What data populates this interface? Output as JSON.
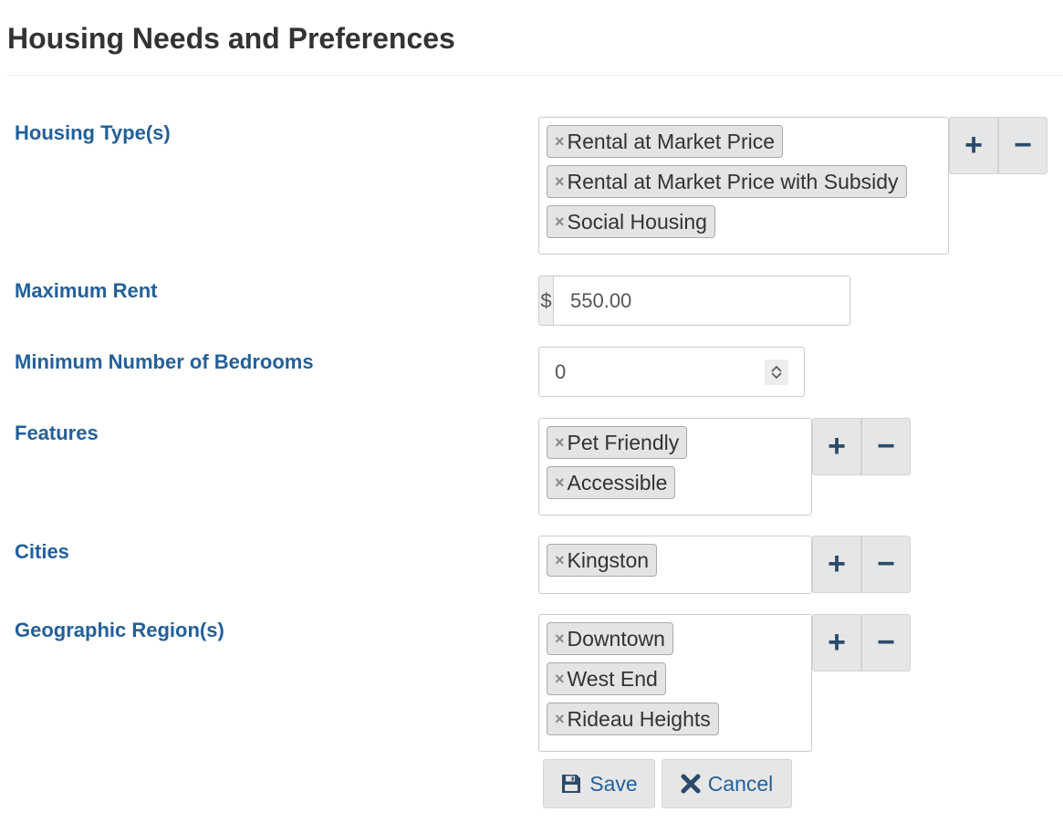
{
  "page": {
    "title": "Housing Needs and Preferences"
  },
  "housing_types": {
    "label": "Housing Type(s)",
    "tags": [
      "Rental at Market Price",
      "Rental at Market Price with Subsidy",
      "Social Housing"
    ]
  },
  "max_rent": {
    "label": "Maximum Rent",
    "currency": "$",
    "value": "550.00"
  },
  "min_bedrooms": {
    "label": "Minimum Number of Bedrooms",
    "value": "0"
  },
  "features": {
    "label": "Features",
    "tags": [
      "Pet Friendly",
      "Accessible"
    ]
  },
  "cities": {
    "label": "Cities",
    "tags": [
      "Kingston"
    ]
  },
  "regions": {
    "label": "Geographic Region(s)",
    "tags": [
      "Downtown",
      "West End",
      "Rideau Heights"
    ]
  },
  "controls": {
    "remove_glyph": "×",
    "add_glyph": "+",
    "remove_all_glyph": "−"
  },
  "actions": {
    "save_label": "Save",
    "cancel_label": "Cancel"
  },
  "colors": {
    "label": "#23609a",
    "button_bg": "#e6e6e6",
    "tag_bg": "#e4e4e4",
    "icon": "#2b4a6b"
  }
}
